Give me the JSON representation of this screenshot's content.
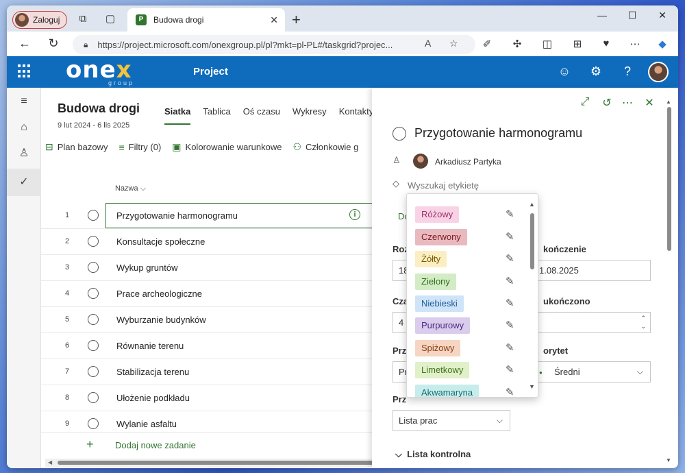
{
  "browser": {
    "profile_label": "Zaloguj",
    "tab_title": "Budowa drogi",
    "tab_favicon": "P",
    "url": "https://project.microsoft.com/onexgroup.pl/pl?mkt=pl-PL#/taskgrid?projec..."
  },
  "appbar": {
    "logo_main": "one",
    "logo_accent": "x",
    "logo_sub": "group",
    "app_title": "Project"
  },
  "plan": {
    "title": "Budowa drogi",
    "dates": "9 lut 2024 - 6 lis 2025",
    "tabs": [
      "Siatka",
      "Tablica",
      "Oś czasu",
      "Wykresy",
      "Kontakty"
    ],
    "toolbar": [
      "Plan bazowy",
      "Filtry (0)",
      "Kolorowanie warunkowe",
      "Członkowie g"
    ],
    "column_name": "Nazwa"
  },
  "tasks": [
    {
      "num": "1",
      "name": "Przygotowanie harmonogramu"
    },
    {
      "num": "2",
      "name": "Konsultacje społeczne"
    },
    {
      "num": "3",
      "name": "Wykup gruntów"
    },
    {
      "num": "4",
      "name": "Prace archeologiczne"
    },
    {
      "num": "5",
      "name": "Wyburzanie budynków"
    },
    {
      "num": "6",
      "name": "Równanie terenu"
    },
    {
      "num": "7",
      "name": "Stabilizacja terenu"
    },
    {
      "num": "8",
      "name": "Ułożenie podkładu"
    },
    {
      "num": "9",
      "name": "Wylanie asfaltu"
    }
  ],
  "add_task_label": "Dodaj nowe zadanie",
  "details": {
    "task_title": "Przygotowanie harmonogramu",
    "assignee": "Arkadiusz Partyka",
    "label_placeholder": "Wyszukaj etykietę",
    "green_link": "Do",
    "label_start": "Roz",
    "start_value": "18",
    "label_end": "kończenie",
    "end_value": "1.08.2025",
    "label_duration": "Cza",
    "duration_value": "4",
    "label_done": "ukończono",
    "label_progress": "Prz",
    "progress_value": "Pr",
    "label_priority": "orytet",
    "priority_value": "Średni",
    "label_bucket": "Prz",
    "bucket_value": "Lista prac",
    "checklist": "Lista kontrolna"
  },
  "labels": [
    {
      "name": "Różowy",
      "bg": "#f8d3e6",
      "fg": "#a02d6a"
    },
    {
      "name": "Czerwony",
      "bg": "#e8b9bf",
      "fg": "#7c1a23"
    },
    {
      "name": "Żółty",
      "bg": "#fbeec2",
      "fg": "#7a5a00"
    },
    {
      "name": "Zielony",
      "bg": "#d3ecc5",
      "fg": "#2b6d1e"
    },
    {
      "name": "Niebieski",
      "bg": "#cfe4f8",
      "fg": "#1b5b9a"
    },
    {
      "name": "Purpurowy",
      "bg": "#d9ccec",
      "fg": "#4e2a84"
    },
    {
      "name": "Spiżowy",
      "bg": "#f6d5c2",
      "fg": "#8a3f12"
    },
    {
      "name": "Limetkowy",
      "bg": "#e0f0c8",
      "fg": "#44721e"
    },
    {
      "name": "Akwamaryna",
      "bg": "#c7ecec",
      "fg": "#1a6c6c"
    }
  ],
  "colors": {
    "accent": "#31752f",
    "appbar": "#0f6cbd"
  }
}
